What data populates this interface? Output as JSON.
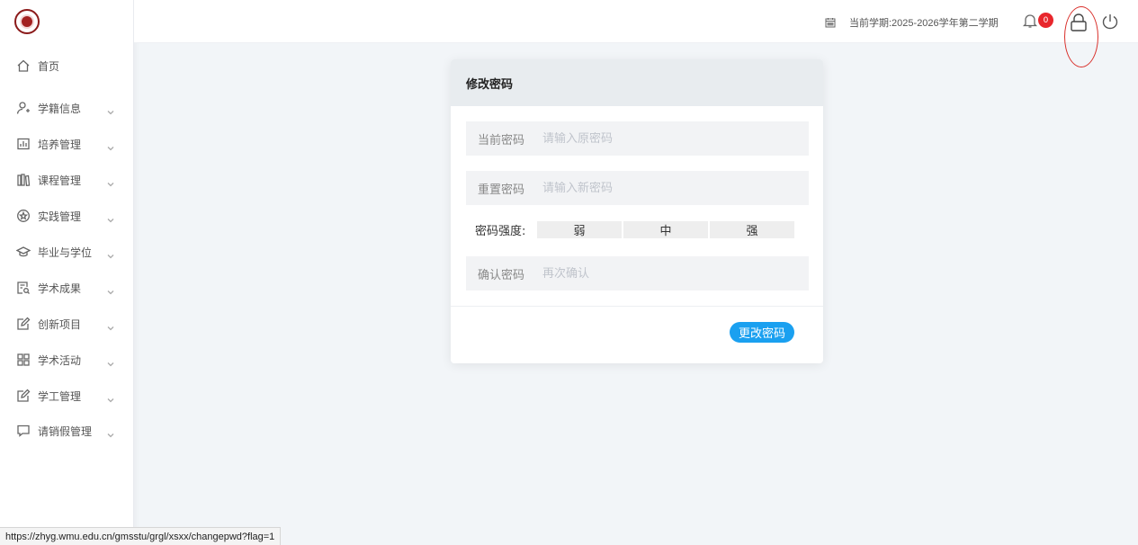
{
  "sidebar": {
    "items": [
      {
        "label": "首页",
        "icon": "home-icon",
        "has_children": false
      },
      {
        "label": "学籍信息",
        "icon": "user-add-icon",
        "has_children": true
      },
      {
        "label": "培养管理",
        "icon": "chart-doc-icon",
        "has_children": true
      },
      {
        "label": "课程管理",
        "icon": "books-icon",
        "has_children": true
      },
      {
        "label": "实践管理",
        "icon": "star-circle-icon",
        "has_children": true
      },
      {
        "label": "毕业与学位",
        "icon": "graduation-cap-icon",
        "has_children": true
      },
      {
        "label": "学术成果",
        "icon": "search-doc-icon",
        "has_children": true
      },
      {
        "label": "创新项目",
        "icon": "edit-icon",
        "has_children": true
      },
      {
        "label": "学术活动",
        "icon": "grid-icon",
        "has_children": true
      },
      {
        "label": "学工管理",
        "icon": "edit-icon",
        "has_children": true
      },
      {
        "label": "请销假管理",
        "icon": "chat-icon",
        "has_children": true
      }
    ]
  },
  "header": {
    "term": "当前学期:2025-2026学年第二学期",
    "notification_count": "0"
  },
  "modal": {
    "title": "修改密码",
    "current_password": {
      "label": "当前密码",
      "placeholder": "请输入原密码"
    },
    "new_password": {
      "label": "重置密码",
      "placeholder": "请输入新密码"
    },
    "strength": {
      "label": "密码强度:",
      "levels": [
        "弱",
        "中",
        "强"
      ]
    },
    "confirm_password": {
      "label": "确认密码",
      "placeholder": "再次确认"
    },
    "submit_label": "更改密码"
  },
  "statusbar": {
    "url": "https://zhyg.wmu.edu.cn/gmsstu/grgl/xsxx/changepwd?flag=1"
  },
  "colors": {
    "accent": "#1aa0f0",
    "badge": "#e8262c",
    "highlight_circle": "#d9302b"
  }
}
